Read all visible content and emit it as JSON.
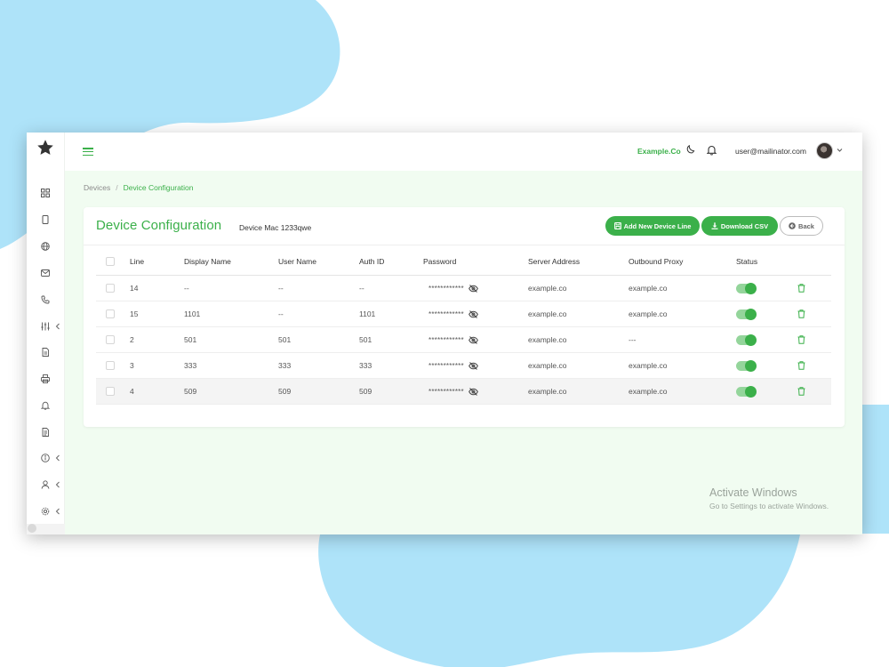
{
  "topbar": {
    "company": "Example.Co",
    "user_email": "user@mailinator.com"
  },
  "breadcrumb": {
    "parent": "Devices",
    "separator": "/",
    "current": "Device Configuration"
  },
  "card": {
    "title": "Device Configuration",
    "subtitle": "Device Mac 1233qwe",
    "buttons": {
      "add_line": "Add New Device Line",
      "download_csv": "Download CSV",
      "back": "Back"
    }
  },
  "table": {
    "headers": {
      "line": "Line",
      "display_name": "Display Name",
      "user_name": "User Name",
      "auth_id": "Auth ID",
      "password": "Password",
      "server_address": "Server Address",
      "outbound_proxy": "Outbound Proxy",
      "status": "Status"
    },
    "rows": [
      {
        "line": "14",
        "display_name": "--",
        "user_name": "--",
        "auth_id": "--",
        "password": "************",
        "server_address": "example.co",
        "outbound_proxy": "example.co",
        "status": "on"
      },
      {
        "line": "15",
        "display_name": "1101",
        "user_name": "--",
        "auth_id": "1101",
        "password": "************",
        "server_address": "example.co",
        "outbound_proxy": "example.co",
        "status": "on"
      },
      {
        "line": "2",
        "display_name": "501",
        "user_name": "501",
        "auth_id": "501",
        "password": "************",
        "server_address": "example.co",
        "outbound_proxy": "---",
        "status": "on"
      },
      {
        "line": "3",
        "display_name": "333",
        "user_name": "333",
        "auth_id": "333",
        "password": "************",
        "server_address": "example.co",
        "outbound_proxy": "example.co",
        "status": "on"
      },
      {
        "line": "4",
        "display_name": "509",
        "user_name": "509",
        "auth_id": "509",
        "password": "************",
        "server_address": "example.co",
        "outbound_proxy": "example.co",
        "status": "on"
      }
    ]
  },
  "sidebar": {
    "items": [
      {
        "icon": "dashboard-icon"
      },
      {
        "icon": "phone-device-icon"
      },
      {
        "icon": "globe-icon"
      },
      {
        "icon": "mail-icon"
      },
      {
        "icon": "phone-call-icon"
      },
      {
        "icon": "sliders-icon"
      },
      {
        "icon": "document-icon"
      },
      {
        "icon": "printer-icon"
      },
      {
        "icon": "bell-icon"
      },
      {
        "icon": "file-text-icon"
      },
      {
        "icon": "info-icon"
      },
      {
        "icon": "user-icon"
      },
      {
        "icon": "settings-icon"
      }
    ]
  },
  "watermark": {
    "line1": "Activate Windows",
    "line2": "Go to Settings to activate Windows."
  },
  "colors": {
    "accent": "#3bb04a",
    "content_bg": "#f1fcf1",
    "blob": "#aee3f9"
  }
}
